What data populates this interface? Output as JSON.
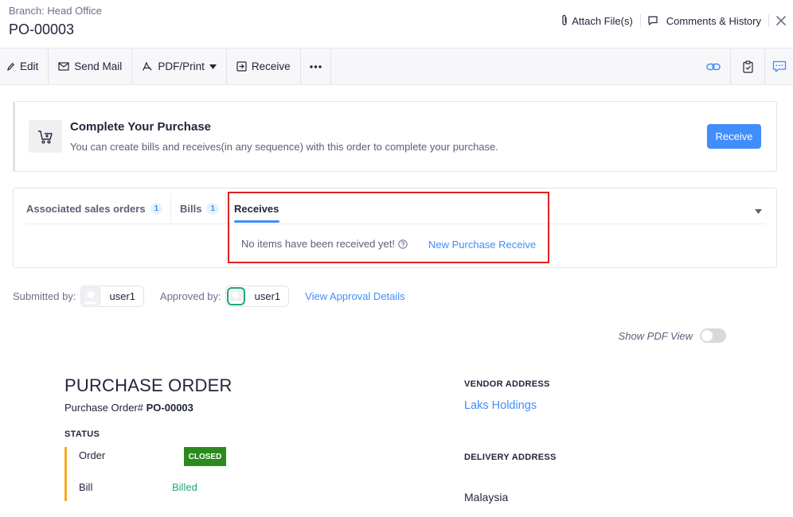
{
  "header": {
    "branch": "Branch: Head Office",
    "title": "PO-00003",
    "attach_label": "Attach File(s)",
    "comments_label": "Comments & History"
  },
  "toolbar": {
    "edit": "Edit",
    "send_mail": "Send Mail",
    "pdf_print": "PDF/Print",
    "receive": "Receive"
  },
  "complete_card": {
    "title": "Complete Your Purchase",
    "subtitle": "You can create bills and receives(in any sequence) with this order to complete your purchase.",
    "button": "Receive"
  },
  "tabs": {
    "items": [
      {
        "label": "Associated sales orders",
        "count": "1"
      },
      {
        "label": "Bills",
        "count": "1"
      },
      {
        "label": "Receives"
      }
    ],
    "empty_message": "No items have been received yet!",
    "new_link": "New Purchase Receive"
  },
  "approval": {
    "submitted_label": "Submitted by:",
    "submitted_user": "user1",
    "approved_label": "Approved by:",
    "approved_user": "user1",
    "view_link": "View Approval Details"
  },
  "pdf_view": {
    "label": "Show PDF View",
    "enabled": false
  },
  "document": {
    "title": "PURCHASE ORDER",
    "po_prefix": "Purchase Order#",
    "po_number": "PO-00003",
    "status_heading": "STATUS",
    "status": [
      {
        "label": "Order",
        "value": "CLOSED"
      },
      {
        "label": "Bill",
        "value": "Billed"
      }
    ],
    "vendor_heading": "VENDOR ADDRESS",
    "vendor_name": "Laks Holdings",
    "delivery_heading": "DELIVERY ADDRESS",
    "delivery_value": "Malaysia"
  },
  "colors": {
    "accent": "#408dfb",
    "closed": "#2b8a1e",
    "billed": "#20a77a",
    "status_bar": "#f5a623",
    "highlight": "#e02020"
  },
  "icons": [
    "paperclip-icon",
    "comment-icon",
    "close-icon",
    "pencil-icon",
    "mail-icon",
    "pdf-icon",
    "caret-down-icon",
    "receive-icon",
    "more-icon",
    "link-icon",
    "clipboard-check-icon",
    "chat-icon",
    "cart-icon",
    "help-icon",
    "user-avatar"
  ]
}
